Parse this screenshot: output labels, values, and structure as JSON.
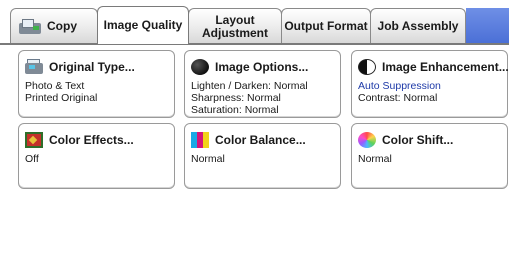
{
  "tabs": {
    "copy": "Copy",
    "image_quality": "Image Quality",
    "layout_line1": "Layout",
    "layout_line2": "Adjustment",
    "output_format": "Output Format",
    "job_assembly": "Job Assembly"
  },
  "cards": {
    "original_type": {
      "title": "Original Type...",
      "line1": "Photo & Text",
      "line2": "Printed Original"
    },
    "image_options": {
      "title": "Image Options...",
      "line1": "Lighten / Darken: Normal",
      "line2": "Sharpness: Normal",
      "line3": "Saturation: Normal"
    },
    "image_enhancement": {
      "title": "Image Enhancement...",
      "line1": "Auto Suppression",
      "line2": "Contrast: Normal"
    },
    "color_effects": {
      "title": "Color Effects...",
      "line1": "Off"
    },
    "color_balance": {
      "title": "Color Balance...",
      "line1": "Normal"
    },
    "color_shift": {
      "title": "Color Shift...",
      "line1": "Normal"
    }
  },
  "colors": {
    "tab_strip_blue": "#4a6fd6",
    "highlight_text": "#1e3aa8",
    "balance_cyan": "#19a9e6",
    "balance_magenta": "#d4157a",
    "balance_yellow": "#f2d21a"
  }
}
